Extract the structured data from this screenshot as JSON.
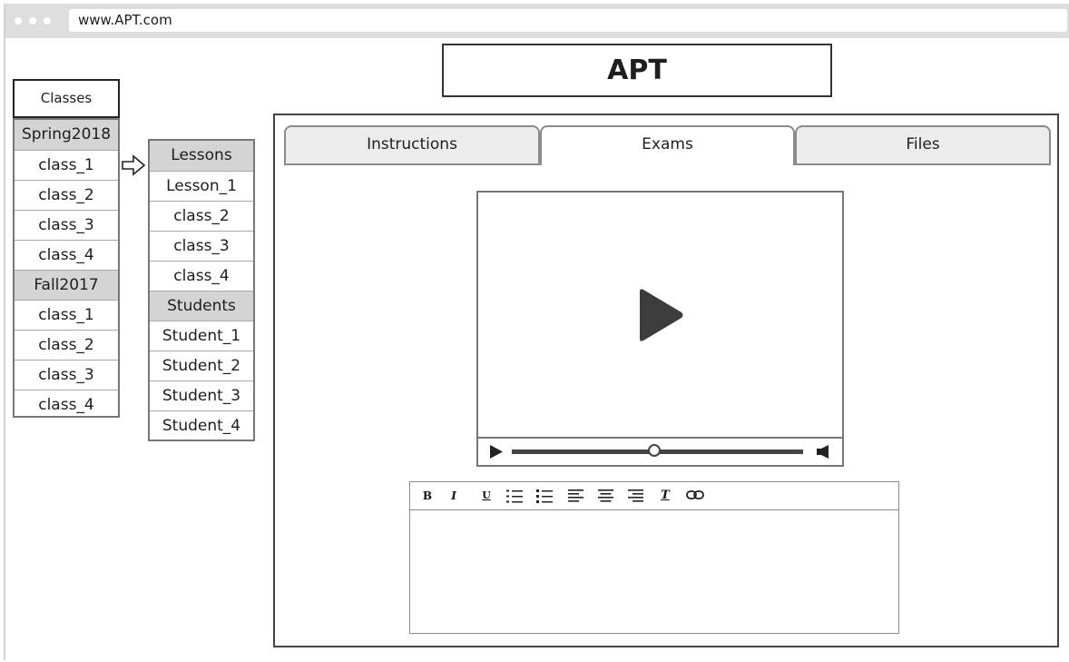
{
  "browser": {
    "url": "www.APT.com"
  },
  "app": {
    "title": "APT"
  },
  "classes": {
    "header": "Classes",
    "rows": [
      {
        "label": "Spring2018",
        "group": true
      },
      {
        "label": "class_1",
        "group": false
      },
      {
        "label": "class_2",
        "group": false
      },
      {
        "label": "class_3",
        "group": false
      },
      {
        "label": "class_4",
        "group": false
      },
      {
        "label": "Fall2017",
        "group": true
      },
      {
        "label": "class_1",
        "group": false
      },
      {
        "label": "class_2",
        "group": false
      },
      {
        "label": "class_3",
        "group": false
      },
      {
        "label": "class_4",
        "group": false
      }
    ]
  },
  "lessons": {
    "rows": [
      {
        "label": "Lessons",
        "group": true
      },
      {
        "label": "Lesson_1",
        "group": false
      },
      {
        "label": "class_2",
        "group": false
      },
      {
        "label": "class_3",
        "group": false
      },
      {
        "label": "class_4",
        "group": false
      },
      {
        "label": "Students",
        "group": true
      },
      {
        "label": "Student_1",
        "group": false
      },
      {
        "label": "Student_2",
        "group": false
      },
      {
        "label": "Student_3",
        "group": false
      },
      {
        "label": "Student_4",
        "group": false
      }
    ]
  },
  "tabs": [
    {
      "label": "Instructions",
      "active": false
    },
    {
      "label": "Exams",
      "active": true
    },
    {
      "label": "Files",
      "active": false
    }
  ],
  "player": {
    "progress": 0.49
  },
  "editor": {
    "toolbar": [
      {
        "name": "bold-button",
        "icon": "bold-icon",
        "glyph": "B"
      },
      {
        "name": "italic-button",
        "icon": "italic-icon",
        "glyph": "I"
      },
      {
        "name": "underline-button",
        "icon": "underline-icon",
        "glyph": "U"
      },
      {
        "name": "numbered-list-button",
        "icon": "numbered-list-icon"
      },
      {
        "name": "bulleted-list-button",
        "icon": "bulleted-list-icon"
      },
      {
        "name": "align-left-button",
        "icon": "align-left-icon"
      },
      {
        "name": "align-center-button",
        "icon": "align-center-icon"
      },
      {
        "name": "align-right-button",
        "icon": "align-right-icon"
      },
      {
        "name": "clear-format-button",
        "icon": "clear-format-icon",
        "glyph": "T"
      },
      {
        "name": "link-button",
        "icon": "link-icon"
      }
    ],
    "body": ""
  },
  "colors": {
    "group_row": "#d4d4d4",
    "tab_inactive": "#ececec",
    "chrome": "#dedede"
  }
}
